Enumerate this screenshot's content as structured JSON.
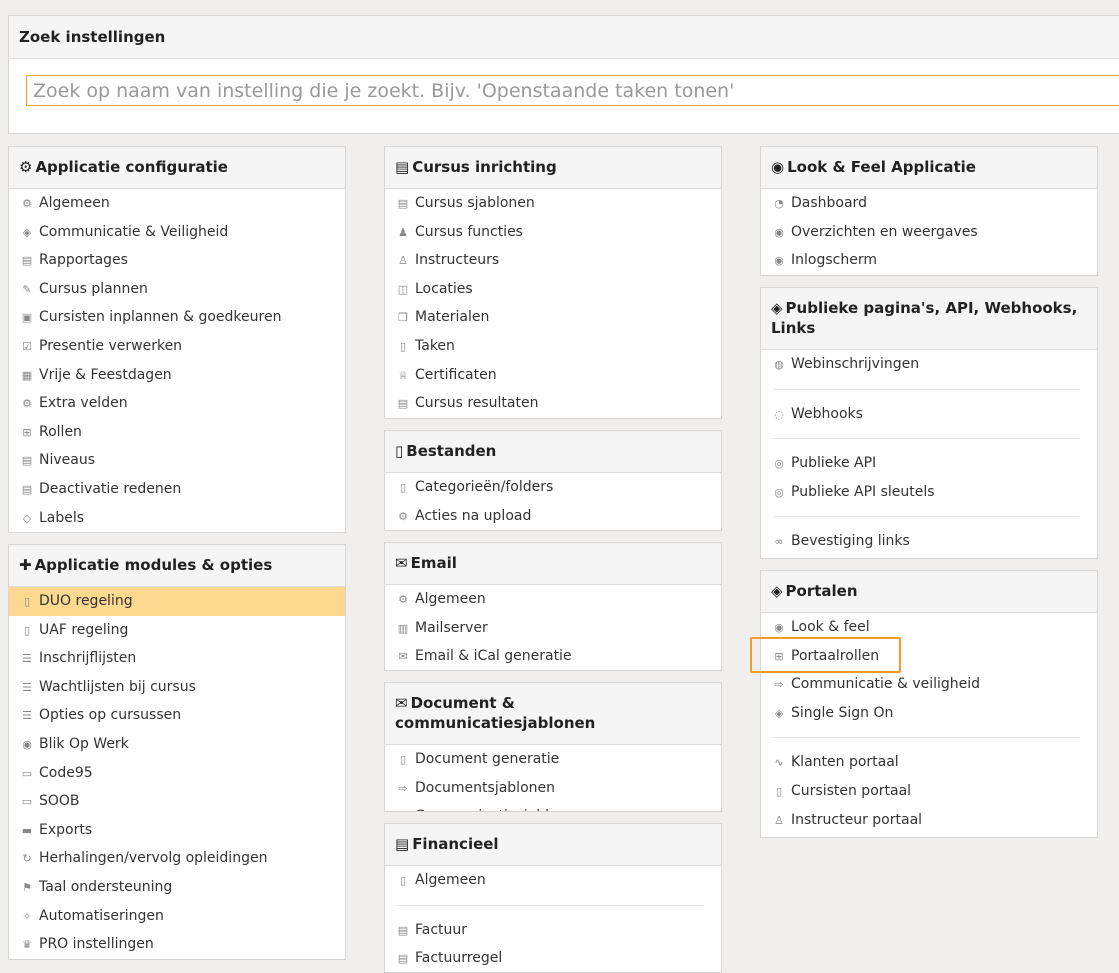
{
  "search": {
    "title": "Zoek instellingen",
    "placeholder": "Zoek op naam van instelling die je zoekt. Bijv. 'Openstaande taken tonen'",
    "value": ""
  },
  "panels": {
    "app_config": {
      "title": "Applicatie configuratie",
      "icon": "gears-icon",
      "items": [
        {
          "label": "Algemeen",
          "icon": "gears-icon"
        },
        {
          "label": "Communicatie & Veiligheid",
          "icon": "shield-icon"
        },
        {
          "label": "Rapportages",
          "icon": "chart-icon"
        },
        {
          "label": "Cursus plannen",
          "icon": "calendar-edit-icon"
        },
        {
          "label": "Cursisten inplannen & goedkeuren",
          "icon": "calendar-user-icon"
        },
        {
          "label": "Presentie verwerken",
          "icon": "checkbox-icon"
        },
        {
          "label": "Vrije & Feestdagen",
          "icon": "calendar-icon"
        },
        {
          "label": "Extra velden",
          "icon": "gears-icon"
        },
        {
          "label": "Rollen",
          "icon": "grid-icon"
        },
        {
          "label": "Niveaus",
          "icon": "chart-icon"
        },
        {
          "label": "Deactivatie redenen",
          "icon": "chart-icon"
        },
        {
          "label": "Labels",
          "icon": "tag-icon"
        }
      ]
    },
    "app_modules": {
      "title": "Applicatie modules & opties",
      "icon": "puzzle-icon",
      "items": [
        {
          "label": "DUO regeling",
          "icon": "document-icon",
          "active": true
        },
        {
          "label": "UAF regeling",
          "icon": "document-icon"
        },
        {
          "label": "Inschrijflijsten",
          "icon": "list-icon"
        },
        {
          "label": "Wachtlijsten bij cursus",
          "icon": "list-icon"
        },
        {
          "label": "Opties op cursussen",
          "icon": "list-icon"
        },
        {
          "label": "Blik Op Werk",
          "icon": "eye-icon"
        },
        {
          "label": "Code95",
          "icon": "truck-icon"
        },
        {
          "label": "SOOB",
          "icon": "truck-icon"
        },
        {
          "label": "Exports",
          "icon": "keyboard-icon"
        },
        {
          "label": "Herhalingen/vervolg opleidingen",
          "icon": "refresh-icon"
        },
        {
          "label": "Taal ondersteuning",
          "icon": "flag-icon"
        },
        {
          "label": "Automatiseringen",
          "icon": "magic-wand-icon"
        },
        {
          "label": "PRO instellingen",
          "icon": "crown-icon"
        }
      ]
    },
    "cursus": {
      "title": "Cursus inrichting",
      "icon": "book-icon",
      "items": [
        {
          "label": "Cursus sjablonen",
          "icon": "book-icon"
        },
        {
          "label": "Cursus functies",
          "icon": "users-icon"
        },
        {
          "label": "Instructeurs",
          "icon": "user-icon"
        },
        {
          "label": "Locaties",
          "icon": "map-icon"
        },
        {
          "label": "Materialen",
          "icon": "boxes-icon"
        },
        {
          "label": "Taken",
          "icon": "clipboard-icon"
        },
        {
          "label": "Certificaten",
          "icon": "trophy-icon"
        },
        {
          "label": "Cursus resultaten",
          "icon": "chart-icon"
        }
      ]
    },
    "bestanden": {
      "title": "Bestanden",
      "icon": "file-icon",
      "items": [
        {
          "label": "Categorieën/folders",
          "icon": "folder-icon"
        },
        {
          "label": "Acties na upload",
          "icon": "gears-icon"
        }
      ]
    },
    "email": {
      "title": "Email",
      "icon": "envelope-icon",
      "items": [
        {
          "label": "Algemeen",
          "icon": "gears-icon"
        },
        {
          "label": "Mailserver",
          "icon": "server-icon"
        },
        {
          "label": "Email & iCal generatie",
          "icon": "envelope-icon"
        }
      ]
    },
    "document": {
      "title": "Document & communicatiesjablonen",
      "icon": "envelope-icon",
      "items": [
        {
          "label": "Document generatie",
          "icon": "document-icon"
        },
        {
          "label": "Documentsjablonen",
          "icon": "file-arrow-icon"
        },
        {
          "label": "Communicatiesjablonen",
          "icon": "file-arrow-icon"
        }
      ]
    },
    "financieel": {
      "title": "Financieel",
      "icon": "invoice-icon",
      "items": [
        {
          "label": "Algemeen",
          "icon": "document-icon"
        },
        {
          "label": "Factuur",
          "icon": "invoice-icon"
        },
        {
          "label": "Factuurregel",
          "icon": "invoice-icon"
        }
      ]
    },
    "look": {
      "title": "Look & Feel Applicatie",
      "icon": "eye-icon",
      "items": [
        {
          "label": "Dashboard",
          "icon": "dashboard-icon"
        },
        {
          "label": "Overzichten en weergaves",
          "icon": "eye-icon"
        },
        {
          "label": "Inlogscherm",
          "icon": "eye-icon"
        }
      ]
    },
    "publiek": {
      "title": "Publieke pagina's, API, Webhooks, Links",
      "icon": "cube-icon",
      "items": [
        {
          "label": "Webinschrijvingen",
          "icon": "globe-icon"
        },
        {
          "label": "Webhooks",
          "icon": "webhook-icon"
        },
        {
          "label": "Publieke API",
          "icon": "api-icon"
        },
        {
          "label": "Publieke API sleutels",
          "icon": "api-icon"
        },
        {
          "label": "Bevestiging links",
          "icon": "link-icon"
        }
      ]
    },
    "portalen": {
      "title": "Portalen",
      "icon": "cube-icon",
      "items": [
        {
          "label": "Look & feel",
          "icon": "eye-icon"
        },
        {
          "label": "Portaalrollen",
          "icon": "grid-icon"
        },
        {
          "label": "Communicatie & veiligheid",
          "icon": "file-arrow-icon"
        },
        {
          "label": "Single Sign On",
          "icon": "shield-icon"
        },
        {
          "label": "Klanten portaal",
          "icon": "chart-line-icon"
        },
        {
          "label": "Cursisten portaal",
          "icon": "id-card-icon"
        },
        {
          "label": "Instructeur portaal",
          "icon": "user-icon"
        }
      ]
    }
  }
}
